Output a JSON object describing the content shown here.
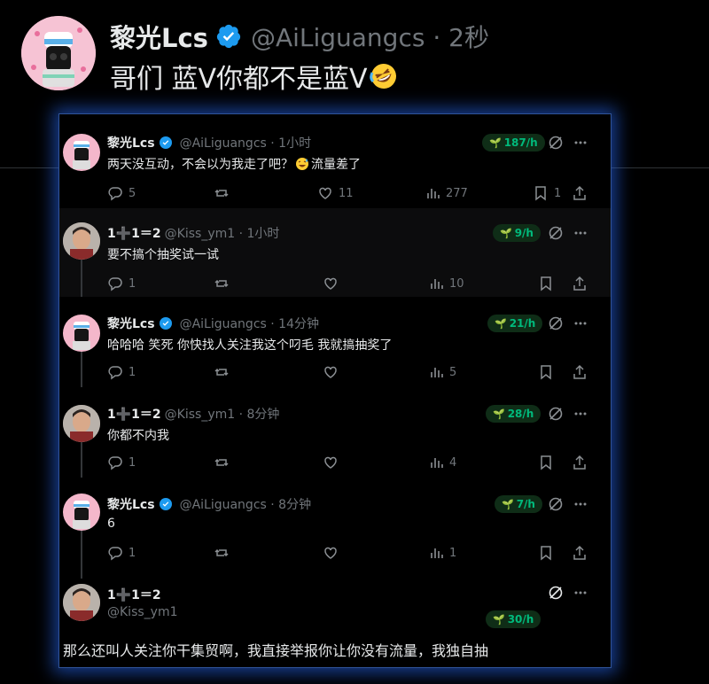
{
  "outer": {
    "name": "黎光Lcs",
    "handle": "@AiLiguangcs · 2秒",
    "text": "哥们 蓝V你都不是蓝V"
  },
  "thread": [
    {
      "name": "黎光Lcs",
      "handle": "@AiLiguangcs · 1小时",
      "text_before": "两天没互动，不会以为我走了吧？",
      "text_after": "流量差了",
      "views_rate": "187/h",
      "replies": "5",
      "retweets": "",
      "likes": "11",
      "views": "277",
      "bookmarks": "1"
    },
    {
      "name": "1➕1＝2",
      "handle": "@Kiss_ym1 · 1小时",
      "text": "要不搞个抽奖试一试",
      "views_rate": "9/h",
      "replies": "1",
      "views": "10"
    },
    {
      "name": "黎光Lcs",
      "handle": "@AiLiguangcs · 14分钟",
      "text": "哈哈哈 笑死 你快找人关注我这个叼毛 我就搞抽奖了",
      "views_rate": "21/h",
      "replies": "1",
      "views": "5"
    },
    {
      "name": "1➕1＝2",
      "handle": "@Kiss_ym1 · 8分钟",
      "text": "你都不内我",
      "views_rate": "28/h",
      "replies": "1",
      "views": "4"
    },
    {
      "name": "黎光Lcs",
      "handle": "@AiLiguangcs · 8分钟",
      "text": "6",
      "views_rate": "7/h",
      "replies": "1",
      "views": "1"
    },
    {
      "name": "1➕1＝2",
      "handle": "@Kiss_ym1",
      "text": "那么还叫人关注你干集贸啊，我直接举报你让你没有流量，我独自抽",
      "views_rate": "30/h"
    }
  ],
  "colors": {
    "accent": "#1d9bf0",
    "green": "#00ba7c",
    "muted": "#71767b",
    "glow": "#286eff"
  }
}
